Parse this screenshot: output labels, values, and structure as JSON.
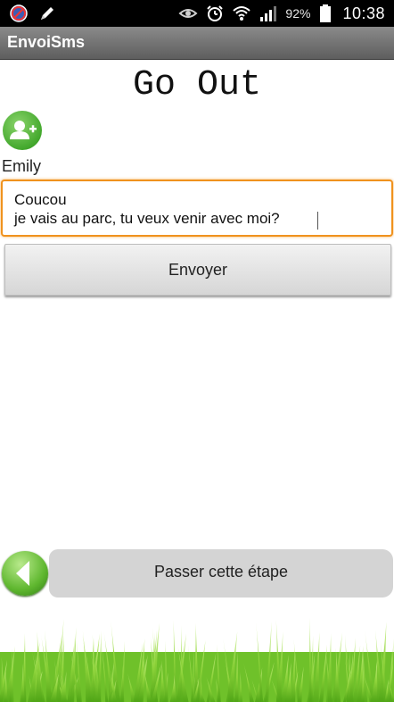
{
  "status_bar": {
    "battery_percent": "92%",
    "time": "10:38",
    "icons": [
      "blocked-app-icon",
      "pencil-icon",
      "eye-icon",
      "alarm-icon",
      "wifi-icon",
      "signal-icon",
      "battery-icon"
    ]
  },
  "action_bar": {
    "title": "EnvoiSms"
  },
  "main": {
    "heading": "Go Out",
    "contact_name": "Emily",
    "message_lines": [
      "Coucou",
      "je vais au parc,  tu veux venir avec moi?"
    ],
    "send_label": "Envoyer",
    "skip_label": "Passer cette étape"
  },
  "colors": {
    "accent_orange": "#f0921e",
    "green": "#43a82d",
    "action_bar": "#6e6e6e"
  }
}
